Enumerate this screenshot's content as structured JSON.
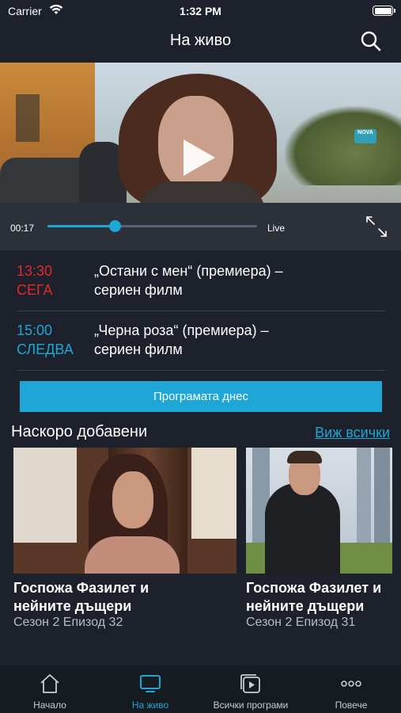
{
  "status_bar": {
    "carrier": "Carrier",
    "time": "1:32 PM"
  },
  "header": {
    "title": "На живо",
    "search_icon": "search-icon"
  },
  "player": {
    "elapsed": "00:17",
    "live_label": "Live",
    "progress_fraction": 0.32,
    "play_icon": "play-icon",
    "fullscreen_icon": "fullscreen-icon",
    "channel_logo": "NOVA"
  },
  "schedule": [
    {
      "time": "13:30",
      "state": "СЕГА",
      "title_line1": "„Остани с мен“ (премиера) –",
      "title_line2": "сериен филм",
      "color": "#e5282a"
    },
    {
      "time": "15:00",
      "state": "СЛЕДВА",
      "title_line1": "„Черна роза“ (премиера) –",
      "title_line2": "сериен филм",
      "color": "#1ea6d6"
    }
  ],
  "program_button": "Програмата днес",
  "recent": {
    "title": "Наскоро добавени",
    "see_all": "Виж всички",
    "items": [
      {
        "title_line1": "Госпожа Фазилет и",
        "title_line2": "нейните дъщери",
        "subtitle": "Сезон 2 Епизод 32"
      },
      {
        "title_line1": "Госпожа Фазилет и",
        "title_line2": "нейните дъщери",
        "subtitle": "Сезон 2 Епизод 31"
      }
    ]
  },
  "tabs": [
    {
      "label": "Начало",
      "icon": "home-icon",
      "active": false
    },
    {
      "label": "На живо",
      "icon": "tv-icon",
      "active": true
    },
    {
      "label": "Всички програми",
      "icon": "programs-icon",
      "active": false
    },
    {
      "label": "Повече",
      "icon": "more-icon",
      "active": false
    }
  ],
  "colors": {
    "accent": "#1ea6d6",
    "now": "#e5282a",
    "background": "#1c212b"
  }
}
